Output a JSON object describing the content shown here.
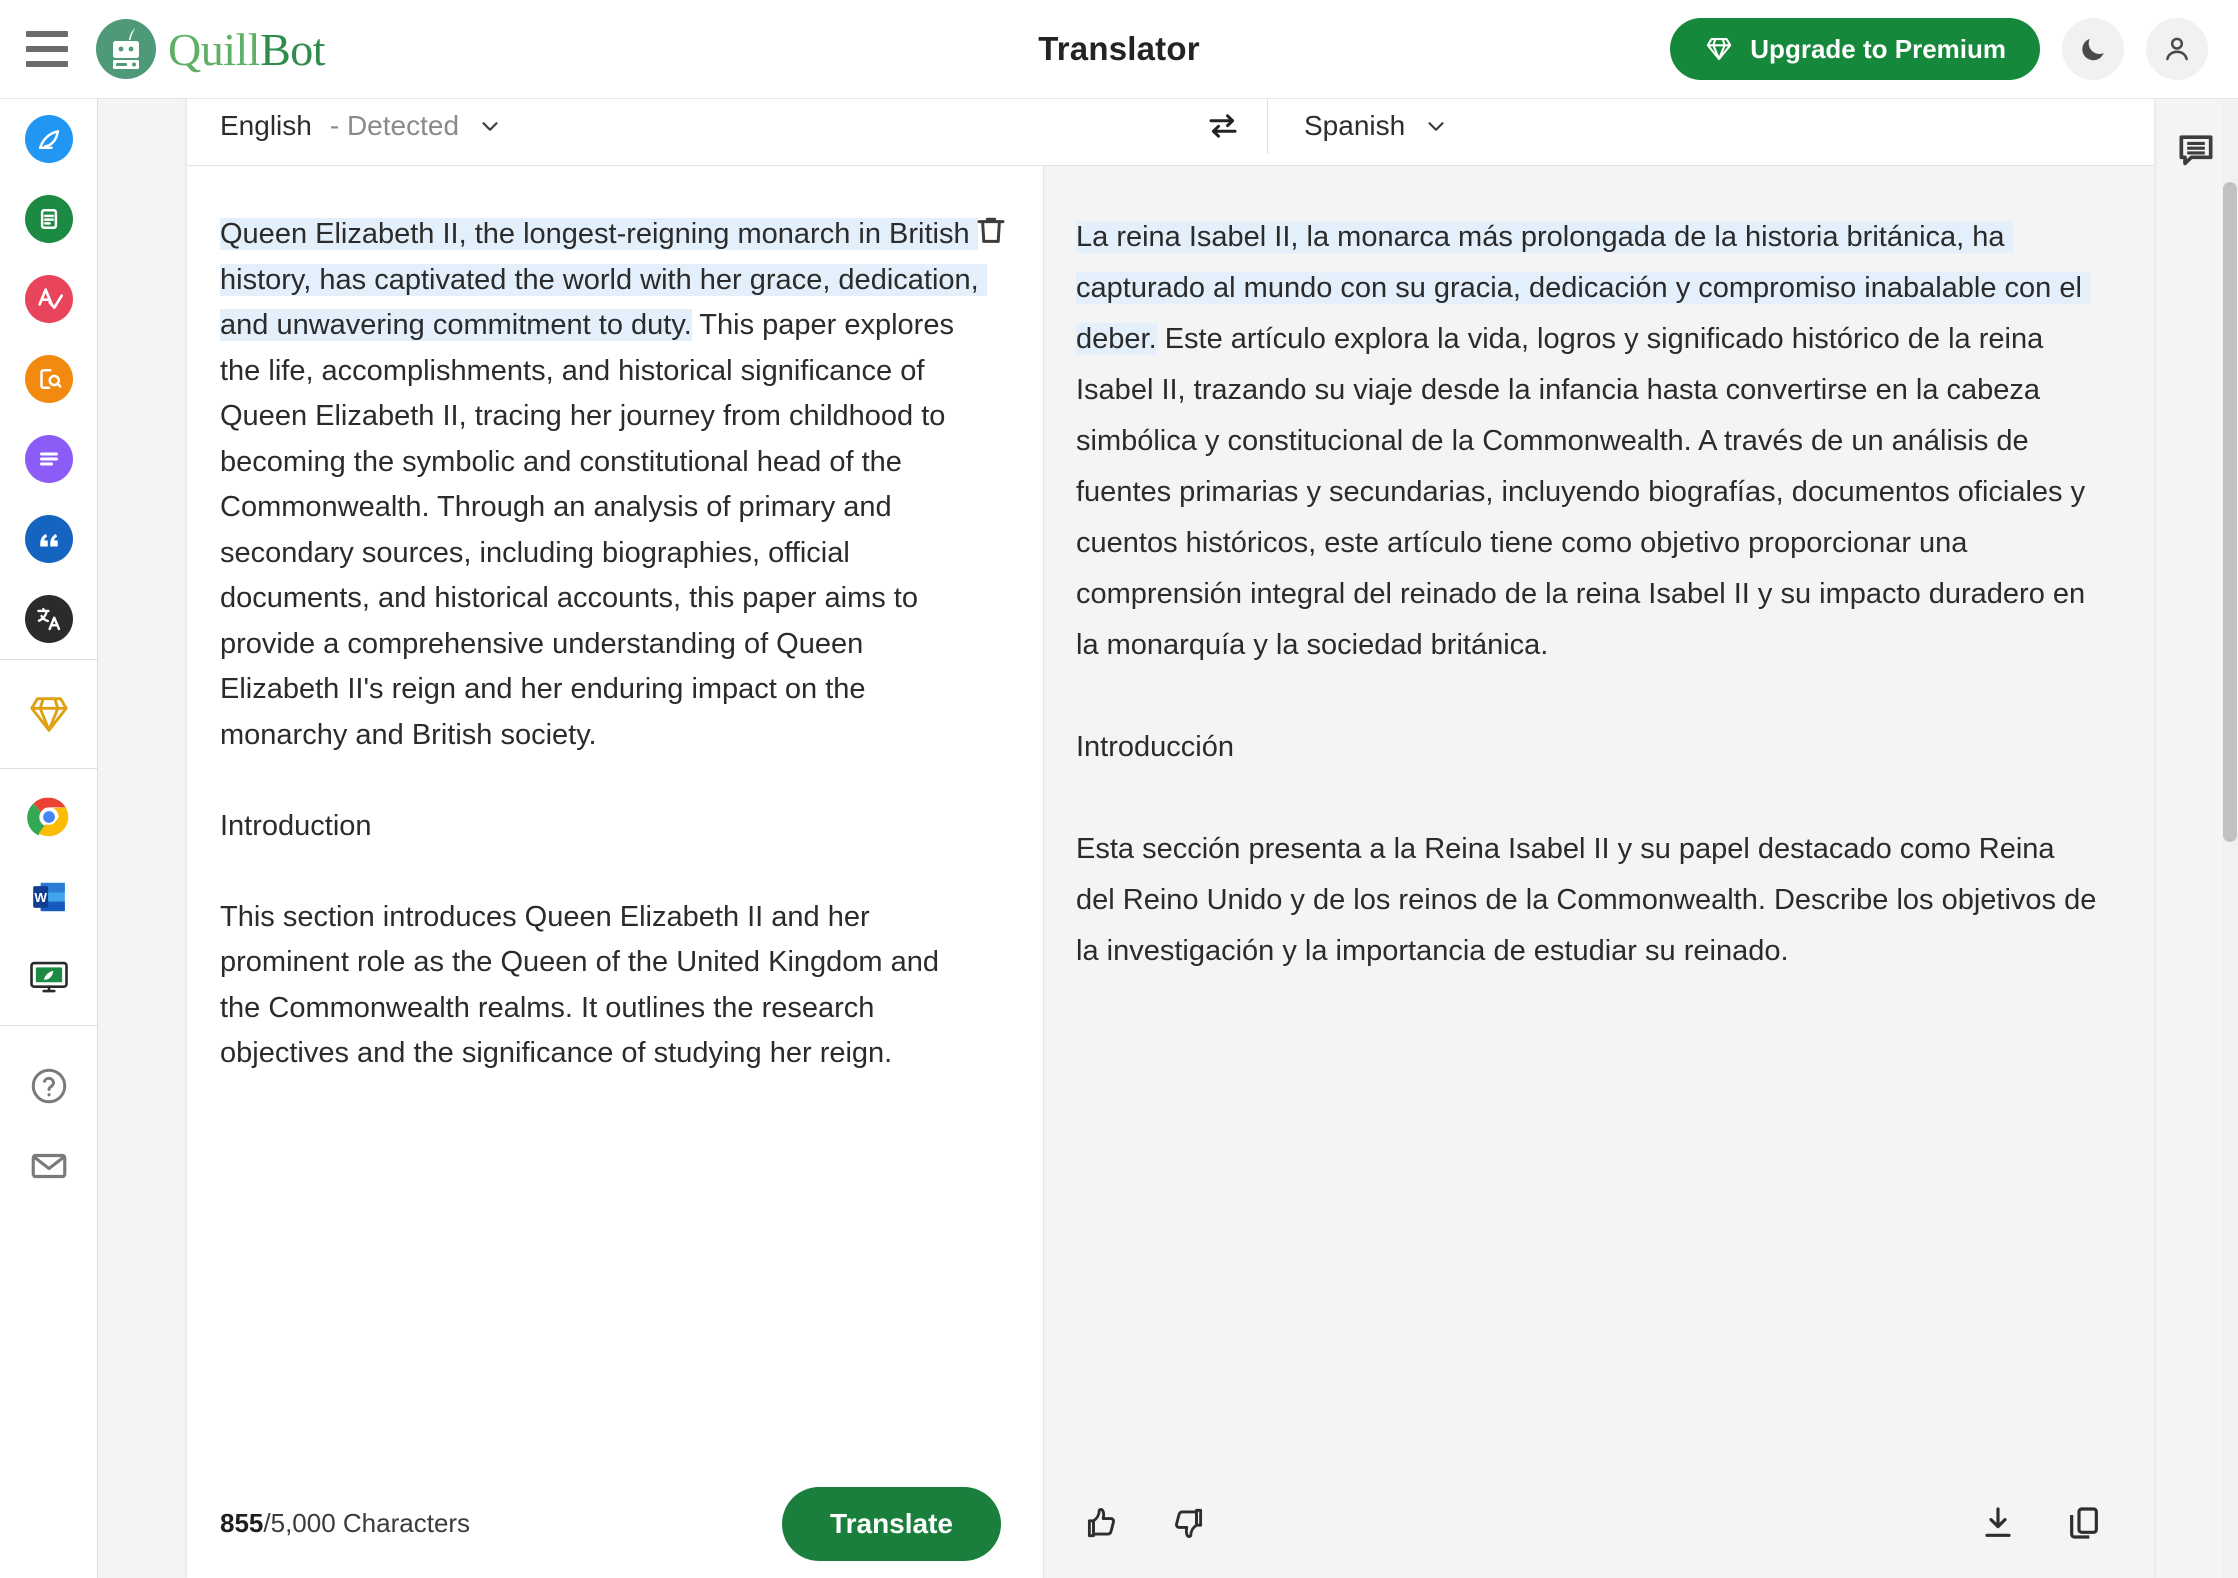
{
  "header": {
    "menu_icon": "hamburger-icon",
    "brand": {
      "part1": "Quill",
      "part2": "Bot",
      "logo_icon": "quillbot-robot-logo"
    },
    "title": "Translator",
    "upgrade_label": "Upgrade to Premium",
    "upgrade_icon": "diamond-icon",
    "upgrade_color": "#16883b",
    "dark_mode_icon": "moon-icon",
    "account_icon": "person-icon"
  },
  "sidebar": {
    "groups": [
      {
        "items": [
          {
            "name": "paraphraser",
            "icon": "feather-quill-icon",
            "color": "#2196f3"
          },
          {
            "name": "grammar-checker",
            "icon": "document-refresh-icon",
            "color": "#1d8a43"
          },
          {
            "name": "ai-detector",
            "icon": "letter-a-check-icon",
            "color": "#e8455c"
          },
          {
            "name": "plagiarism-checker",
            "icon": "document-search-icon",
            "color": "#f28a0f"
          },
          {
            "name": "summarizer",
            "icon": "text-lines-icon",
            "color": "#8b5cf6"
          },
          {
            "name": "citation-generator",
            "icon": "quotation-mark-icon",
            "color": "#1565c0"
          },
          {
            "name": "translator",
            "icon": "translate-icon",
            "color": "#2b2b2b"
          }
        ]
      },
      {
        "items": [
          {
            "name": "premium",
            "icon": "diamond-outline-icon",
            "color": "#dfa012"
          }
        ]
      },
      {
        "items": [
          {
            "name": "chrome-extension",
            "icon": "chrome-icon",
            "color": "#4285f4"
          },
          {
            "name": "word-addin",
            "icon": "microsoft-word-icon",
            "color": "#2b579a"
          },
          {
            "name": "desktop-app",
            "icon": "monitor-quill-icon",
            "color": "#1d8a43"
          }
        ]
      },
      {
        "items": [
          {
            "name": "help",
            "icon": "question-circle-icon",
            "color": "#7a7a7a"
          },
          {
            "name": "contact",
            "icon": "envelope-icon",
            "color": "#7a7a7a"
          }
        ]
      }
    ]
  },
  "translator": {
    "source_language": {
      "label": "English",
      "detected_suffix": "- Detected",
      "chevron": "chevron-down-icon"
    },
    "target_language": {
      "label": "Spanish",
      "chevron": "chevron-down-icon"
    },
    "swap_icon": "swap-arrows-icon",
    "delete_icon": "trash-icon",
    "source_text_parts": {
      "highlighted": "Queen Elizabeth II, the longest-reigning monarch in British history, has captivated the world with her grace, dedication, and unwavering commitment to duty.",
      "rest": " This paper explores the life, accomplishments, and historical significance of Queen Elizabeth II, tracing her journey from childhood to becoming the symbolic and constitutional head of the Commonwealth. Through an analysis of primary and secondary sources, including biographies, official documents, and historical accounts, this paper aims to provide a comprehensive understanding of Queen Elizabeth II's reign and her enduring impact on the monarchy and British society.",
      "heading": "Introduction",
      "paragraph2": "This section introduces Queen Elizabeth II and her prominent role as the Queen of the United Kingdom and the Commonwealth realms. It outlines the research objectives and the significance of studying her reign."
    },
    "target_text_parts": {
      "highlighted": "La reina Isabel II, la monarca más prolongada de la historia británica, ha capturado al mundo con su gracia, dedicación y compromiso inabalable con el deber.",
      "rest": " Este artículo explora la vida, logros y significado histórico de la reina Isabel II, trazando su viaje desde la infancia hasta convertirse en la cabeza simbólica y constitucional de la Commonwealth. A través de un análisis de fuentes primarias y secundarias, incluyendo biografías, documentos oficiales y cuentos históricos, este artículo tiene como objetivo proporcionar una comprensión integral del reinado de la reina Isabel II y su impacto duradero en la monarquía y la sociedad británica.",
      "heading": "Introducción",
      "paragraph2": "Esta sección presenta a la Reina Isabel II y su papel destacado como Reina del Reino Unido y de los reinos de la Commonwealth. Describe los objetivos de la investigación y la importancia de estudiar su reinado."
    },
    "char_count_current": "855",
    "char_count_rest": "/5,000 Characters",
    "translate_label": "Translate",
    "translate_color": "#1a7f3c",
    "highlight_color": "#e3effa",
    "feedback": {
      "thumbs_up_icon": "thumbs-up-icon",
      "thumbs_down_icon": "thumbs-down-icon",
      "download_icon": "download-icon",
      "copy_icon": "copy-icon"
    }
  },
  "right_rail": {
    "feedback_icon": "comment-lines-icon"
  }
}
